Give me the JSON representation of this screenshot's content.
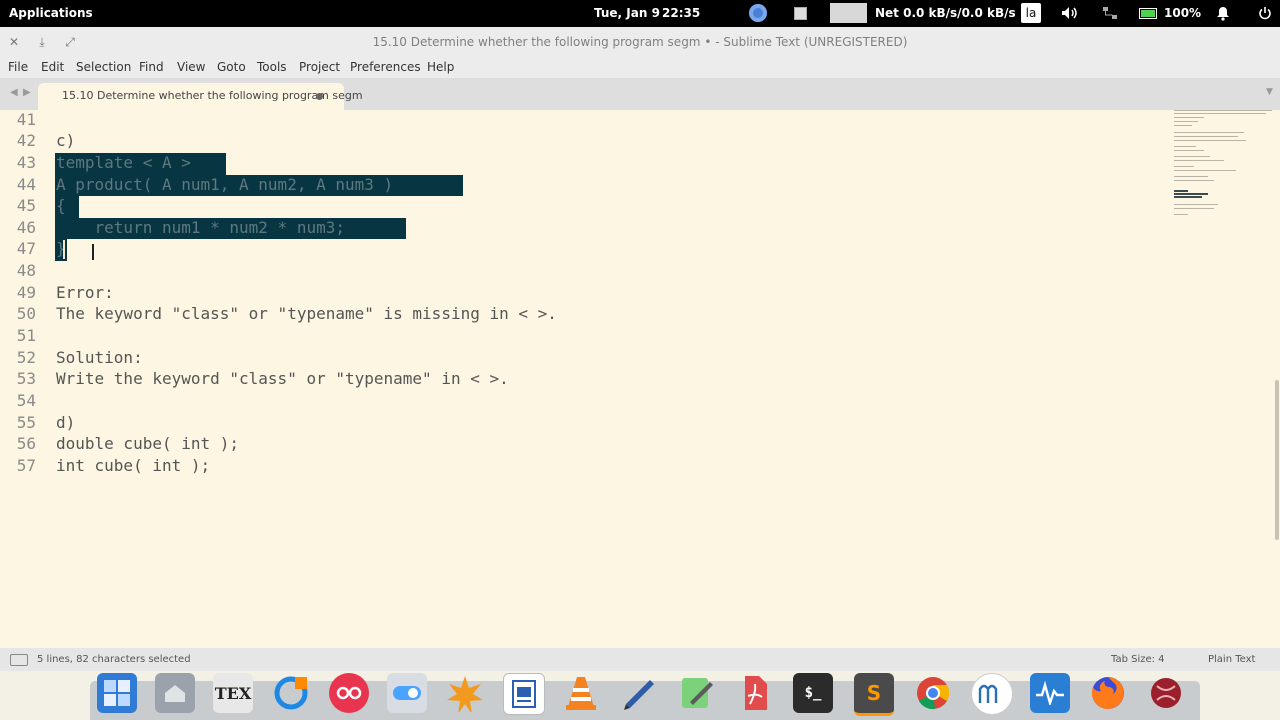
{
  "system_panel": {
    "applications": "Applications",
    "date": "Tue, Jan  9",
    "time": "22:35",
    "net": "Net 0.0 kB/s/0.0 kB/s",
    "keyboard_layout": "la",
    "battery": "100%"
  },
  "window": {
    "title": "15.10 Determine whether the following program segm • - Sublime Text (UNREGISTERED)"
  },
  "menu": [
    "File",
    "Edit",
    "Selection",
    "Find",
    "View",
    "Goto",
    "Tools",
    "Project",
    "Preferences",
    "Help"
  ],
  "tab": {
    "label": "15.10 Determine whether the following program segm"
  },
  "editor": {
    "lines": [
      {
        "n": "41",
        "text": ""
      },
      {
        "n": "42",
        "text": "c)"
      },
      {
        "n": "43",
        "text": "template < A >"
      },
      {
        "n": "44",
        "text": "A product( A num1, A num2, A num3 )"
      },
      {
        "n": "45",
        "text": "{"
      },
      {
        "n": "46",
        "text": "    return num1 * num2 * num3;"
      },
      {
        "n": "47",
        "text": "}"
      },
      {
        "n": "48",
        "text": ""
      },
      {
        "n": "49",
        "text": "Error:"
      },
      {
        "n": "50",
        "text": "The keyword \"class\" or \"typename\" is missing in < >."
      },
      {
        "n": "51",
        "text": ""
      },
      {
        "n": "52",
        "text": "Solution:"
      },
      {
        "n": "53",
        "text": "Write the keyword \"class\" or \"typename\" in < >."
      },
      {
        "n": "54",
        "text": ""
      },
      {
        "n": "55",
        "text": "d)"
      },
      {
        "n": "56",
        "text": "double cube( int );"
      },
      {
        "n": "57",
        "text": "int cube( int );"
      }
    ]
  },
  "status": {
    "selection": "5 lines, 82 characters selected",
    "tab_size": "Tab Size: 4",
    "syntax": "Plain Text"
  },
  "dock": {
    "apps": [
      "file-manager-app",
      "home-folder-app",
      "texmaker-app",
      "screenshot-app",
      "recorder-app",
      "settings-toggle-app",
      "xfig-app",
      "document-viewer-app",
      "vlc-app",
      "drawing-app",
      "text-editor-app",
      "pdf-app",
      "terminal-app",
      "sublime-text-app",
      "chrome-app",
      "musescore-app",
      "system-monitor-app",
      "firefox-app",
      "extra-app"
    ],
    "terminal_label": "$_",
    "texmaker_label": "TEX",
    "sublime_label": "S"
  },
  "colors": {
    "editor_bg": "#fdf6e3",
    "selection": "#073642",
    "top_panel": "#000000"
  }
}
